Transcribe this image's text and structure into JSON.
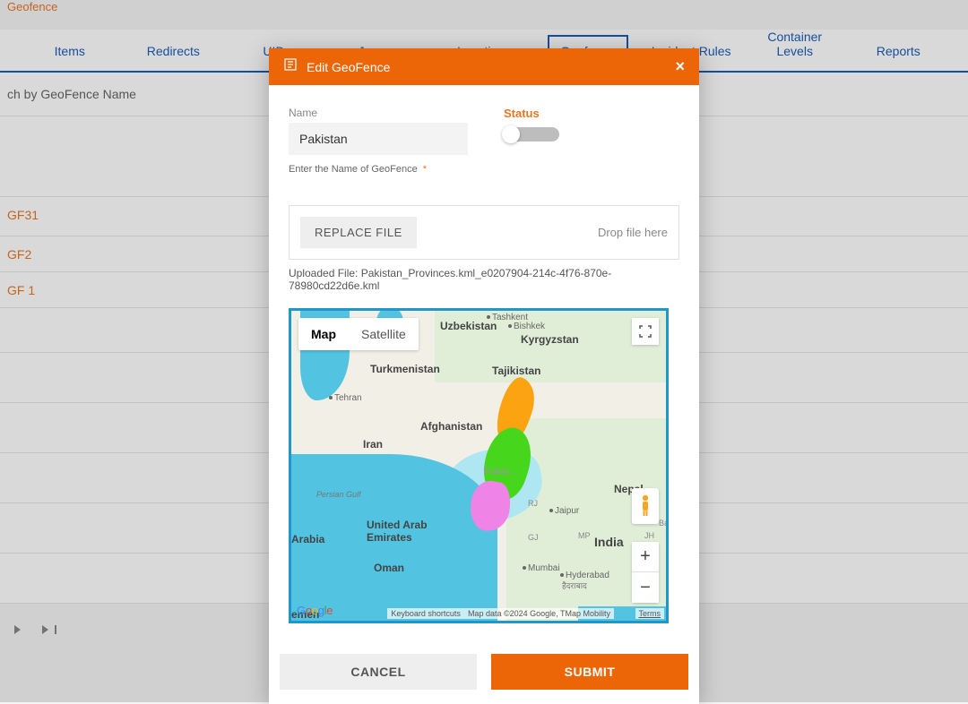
{
  "breadcrumb": {
    "current": "Geofence"
  },
  "tabs": {
    "items": [
      "Items",
      "Redirects",
      "UIDs",
      "Journey",
      "Locations",
      "Geofence",
      "Incident Rules",
      "Container Levels",
      "Reports"
    ],
    "active_index": 5
  },
  "search": {
    "placeholder": "ch by GeoFence Name"
  },
  "list": {
    "items": [
      "GF31",
      "GF2",
      "GF 1"
    ]
  },
  "modal": {
    "title": "Edit GeoFence",
    "name_label": "Name",
    "name_value": "Pakistan",
    "name_helper": "Enter the Name of GeoFence",
    "status_label": "Status",
    "status_on": false,
    "replace_btn": "REPLACE FILE",
    "drop_hint": "Drop file here",
    "uploaded_prefix": "Uploaded File: ",
    "uploaded_file": "Pakistan_Provinces.kml_e0207904-214c-4f76-870e-78980cd22d6e.kml",
    "cancel": "CANCEL",
    "submit": "SUBMIT"
  },
  "map": {
    "type_map": "Map",
    "type_sat": "Satellite",
    "countries": {
      "uzbekistan": "Uzbekistan",
      "kyrgyzstan": "Kyrgyzstan",
      "turkmenistan": "Turkmenistan",
      "tajikistan": "Tajikistan",
      "afghanistan": "Afghanistan",
      "iran": "Iran",
      "uae": "United Arab\nEmirates",
      "oman": "Oman",
      "nepal": "Nepal",
      "india": "India",
      "pakistan": "Pakis...",
      "yemen": "emen",
      "saudi": "Arabia"
    },
    "cities": {
      "tashkent": "Tashkent",
      "bishkek": "Bishkek",
      "jaipur": "Jaipur",
      "mumbai": "Mumbai",
      "hyderabad": "Hyderabad",
      "tehran": "Tehran"
    },
    "other_labels": {
      "persian_gulf": "Persian Gulf",
      "hyd_alt": "हैदराबाद",
      "ba": "Ba",
      "jh": "JH",
      "hyderabad_admin": "GJ",
      "rj": "RJ",
      "mp": "MP"
    },
    "footer": {
      "shortcuts": "Keyboard shortcuts",
      "data": "Map data ©2024 Google, TMap Mobility",
      "terms": "Terms"
    }
  }
}
